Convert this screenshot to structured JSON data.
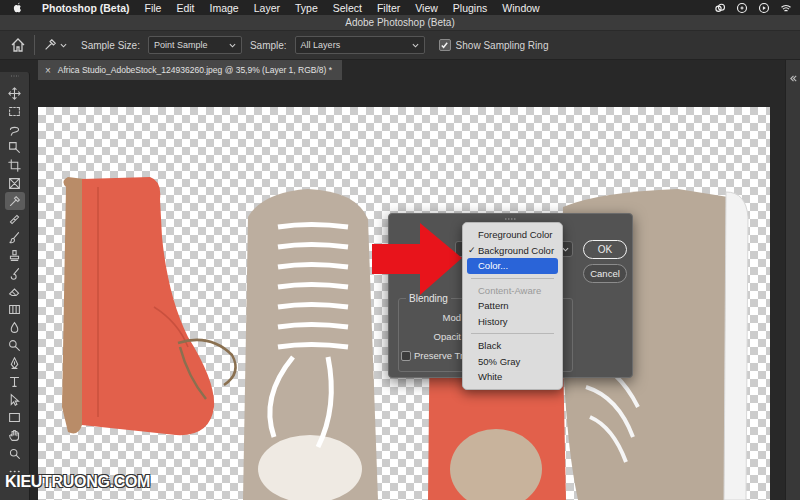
{
  "menu_bar": {
    "app": "Photoshop (Beta)",
    "items": [
      "File",
      "Edit",
      "Image",
      "Layer",
      "Type",
      "Select",
      "Filter",
      "View",
      "Plugins",
      "Window"
    ]
  },
  "window": {
    "title": "Adobe Photoshop (Beta)"
  },
  "options_bar": {
    "sample_size": {
      "label": "Sample Size:",
      "value": "Point Sample"
    },
    "sample": {
      "label": "Sample:",
      "value": "All Layers"
    },
    "sampling_ring": {
      "label": "Show Sampling Ring",
      "checked": true
    }
  },
  "document_tab": {
    "close": "×",
    "title": "Africa Studio_AdobeStock_124936260.jpeg @ 35,9% (Layer 1, RGB/8) *"
  },
  "tools": [
    {
      "kind": "move",
      "selected": false
    },
    {
      "kind": "marquee",
      "selected": false
    },
    {
      "kind": "lasso",
      "selected": false
    },
    {
      "kind": "object-select",
      "selected": false
    },
    {
      "kind": "crop",
      "selected": false
    },
    {
      "kind": "frame",
      "selected": false
    },
    {
      "kind": "eyedropper",
      "selected": true
    },
    {
      "kind": "healing",
      "selected": false
    },
    {
      "kind": "brush",
      "selected": false
    },
    {
      "kind": "stamp",
      "selected": false
    },
    {
      "kind": "history-brush",
      "selected": false
    },
    {
      "kind": "eraser",
      "selected": false
    },
    {
      "kind": "gradient",
      "selected": false
    },
    {
      "kind": "blur",
      "selected": false
    },
    {
      "kind": "dodge",
      "selected": false
    },
    {
      "kind": "pen",
      "selected": false
    },
    {
      "kind": "type",
      "selected": false
    },
    {
      "kind": "path-select",
      "selected": false
    },
    {
      "kind": "rectangle",
      "selected": false
    },
    {
      "kind": "hand",
      "selected": false
    },
    {
      "kind": "zoom",
      "selected": false
    },
    {
      "kind": "more",
      "selected": false
    }
  ],
  "fill_dialog": {
    "buttons": [
      {
        "label": "OK",
        "default": true
      },
      {
        "label": "Cancel",
        "default": false
      }
    ],
    "blending": {
      "title": "Blending",
      "mode_label": "Mod",
      "opacity_label": "Opacit",
      "preserve_transparency": {
        "label": "Preserve Tr",
        "checked": false
      }
    }
  },
  "contents_menu": {
    "check_mark": "✓",
    "items": [
      {
        "kind": "item",
        "label": "Foreground Color",
        "checked": false,
        "selected": false,
        "disabled": false
      },
      {
        "kind": "item",
        "label": "Background Color",
        "checked": true,
        "selected": false,
        "disabled": false
      },
      {
        "kind": "item",
        "label": "Color...",
        "checked": false,
        "selected": true,
        "disabled": false
      },
      {
        "kind": "separator"
      },
      {
        "kind": "item",
        "label": "Content-Aware",
        "checked": false,
        "selected": false,
        "disabled": true
      },
      {
        "kind": "item",
        "label": "Pattern",
        "checked": false,
        "selected": false,
        "disabled": false
      },
      {
        "kind": "item",
        "label": "History",
        "checked": false,
        "selected": false,
        "disabled": false
      },
      {
        "kind": "separator"
      },
      {
        "kind": "item",
        "label": "Black",
        "checked": false,
        "selected": false,
        "disabled": false
      },
      {
        "kind": "item",
        "label": "50% Gray",
        "checked": false,
        "selected": false,
        "disabled": false
      },
      {
        "kind": "item",
        "label": "White",
        "checked": false,
        "selected": false,
        "disabled": false
      }
    ]
  },
  "watermark": "KIEUTRUONG.COM"
}
